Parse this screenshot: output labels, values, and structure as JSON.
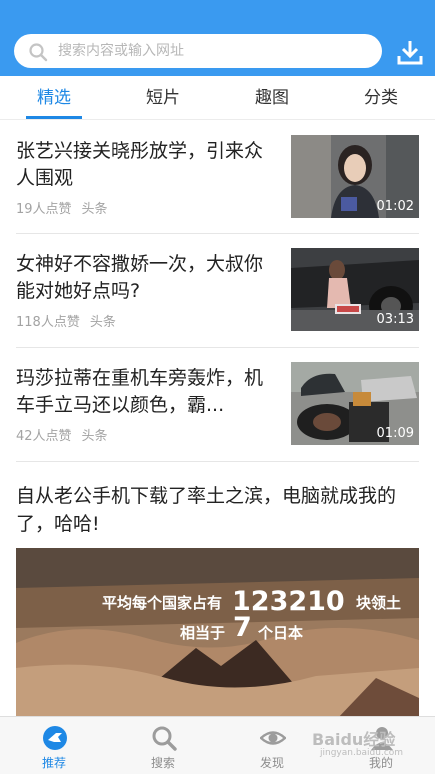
{
  "search": {
    "placeholder": "搜索内容或输入网址"
  },
  "tabs": [
    {
      "label": "精选"
    },
    {
      "label": "短片"
    },
    {
      "label": "趣图"
    },
    {
      "label": "分类"
    }
  ],
  "items": [
    {
      "title": "张艺兴接关晓彤放学，引来众人围观",
      "likes": "19人点赞",
      "source": "头条",
      "duration": "01:02"
    },
    {
      "title": "女神好不容撒娇一次，大叔你能对她好点吗?",
      "likes": "118人点赞",
      "source": "头条",
      "duration": "03:13"
    },
    {
      "title": "玛莎拉蒂在重机车旁轰炸，机车手立马还以颜色，霸...",
      "likes": "42人点赞",
      "source": "头条",
      "duration": "01:09"
    }
  ],
  "big_post": {
    "title": "自从老公手机下载了率土之滨，电脑就成我的了，哈哈!",
    "overlay_prefix": "平均每个国家占有",
    "overlay_number": "123210",
    "overlay_unit": "块领土",
    "overlay_equal": "相当于",
    "overlay_number2": "7",
    "overlay_suffix": "个日本"
  },
  "bottom_nav": [
    {
      "label": "推荐"
    },
    {
      "label": "搜索"
    },
    {
      "label": "发现"
    },
    {
      "label": "我的"
    }
  ],
  "watermark": {
    "text": "Baidu经验",
    "sub": "jingyan.baidu.com"
  },
  "colors": {
    "header": "#3a9af0",
    "accent": "#1e88e5"
  }
}
